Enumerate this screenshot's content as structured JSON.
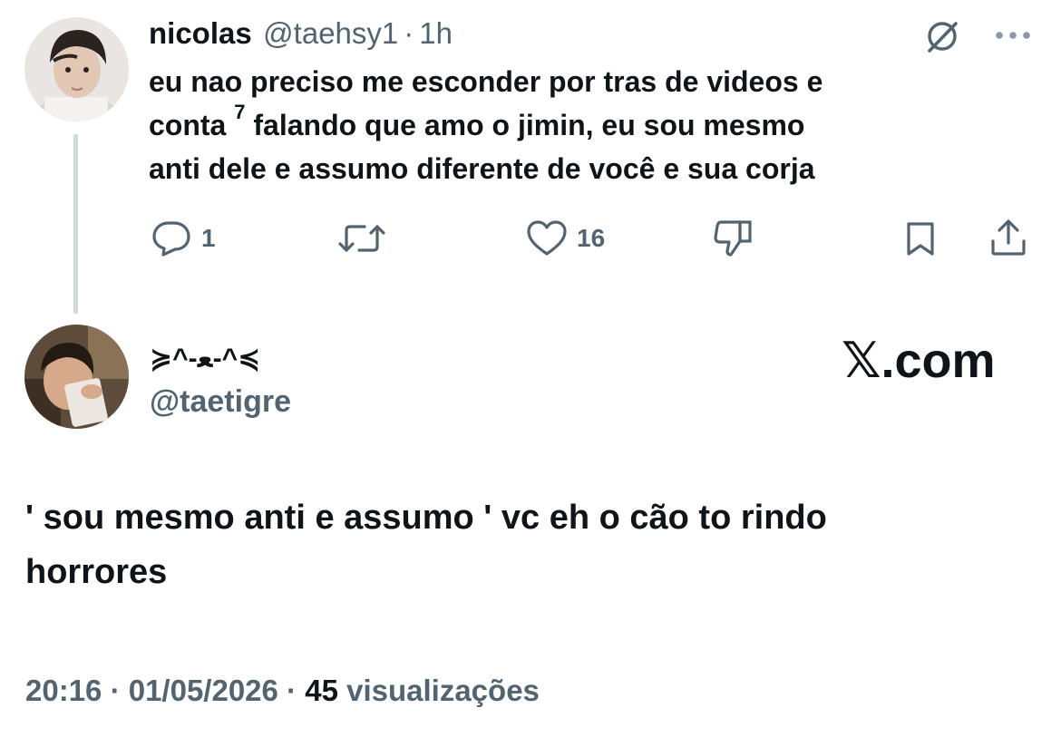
{
  "parent_tweet": {
    "display_name": "nicolas",
    "handle": "@taehsy1",
    "separator": "·",
    "time": "1h",
    "text_line1": "eu nao preciso me esconder por tras de videos e",
    "text_line2a": "conta",
    "text_line2_sup": "7",
    "text_line2b": "falando que amo o jimin, eu sou mesmo",
    "text_line3": "anti dele e assumo diferente de você e sua corja",
    "replies": "1",
    "likes": "16",
    "icons": {
      "grok": "grok-icon",
      "more": "more-icon",
      "reply": "reply-icon",
      "retweet": "retweet-icon",
      "like": "heart-icon",
      "dislike": "dislike-icon",
      "bookmark": "bookmark-icon",
      "share": "share-icon"
    }
  },
  "quoted_tweet": {
    "display_name": "≽^-ﻌ-^≼",
    "handle": "@taetigre",
    "brand": "𝕏.com",
    "text_line1": "' sou mesmo anti e assumo ' vc eh o cão to rindo",
    "text_line2": "horrores",
    "footer_time": "20:16 · 01/05/2026 · ",
    "footer_views": "45",
    "footer_views_label": " visualizações"
  },
  "colors": {
    "text": "#0f1419",
    "secondary": "#536471",
    "thread_line": "#cfd9de"
  }
}
